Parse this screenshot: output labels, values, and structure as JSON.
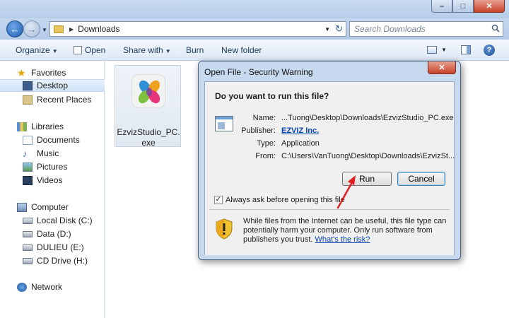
{
  "window": {
    "address": {
      "crumb": "Downloads"
    },
    "search": {
      "placeholder": "Search Downloads"
    }
  },
  "toolbar": {
    "organize": "Organize",
    "open": "Open",
    "share_with": "Share with",
    "burn": "Burn",
    "new_folder": "New folder"
  },
  "navpane": {
    "favorites": "Favorites",
    "desktop": "Desktop",
    "recent_places": "Recent Places",
    "libraries": "Libraries",
    "documents": "Documents",
    "music": "Music",
    "pictures": "Pictures",
    "videos": "Videos",
    "computer": "Computer",
    "local_disk": "Local Disk (C:)",
    "data": "Data (D:)",
    "dulieu": "DULIEU (E:)",
    "cd_drive": "CD Drive (H:)",
    "network": "Network"
  },
  "content": {
    "file_name": "EzvizStudio_PC.exe"
  },
  "dialog": {
    "title": "Open File - Security Warning",
    "question": "Do you want to run this file?",
    "name_label": "Name:",
    "name_value": "...Tuong\\Desktop\\Downloads\\EzvizStudio_PC.exe",
    "publisher_label": "Publisher:",
    "publisher_value": "EZVIZ Inc.",
    "type_label": "Type:",
    "type_value": "Application",
    "from_label": "From:",
    "from_value": "C:\\Users\\VanTuong\\Desktop\\Downloads\\EzvizSt...",
    "run_button": "Run",
    "cancel_button": "Cancel",
    "checkbox_label": "Always ask before opening this file",
    "checkbox_checked": true,
    "warning_text": "While files from the Internet can be useful, this file type can potentially harm your computer. Only run software from publishers you trust.",
    "warning_link": "What's the risk?"
  },
  "colors": {
    "link": "#0645ad",
    "annotation_arrow": "#e02020",
    "close_button": "#c7432a"
  }
}
